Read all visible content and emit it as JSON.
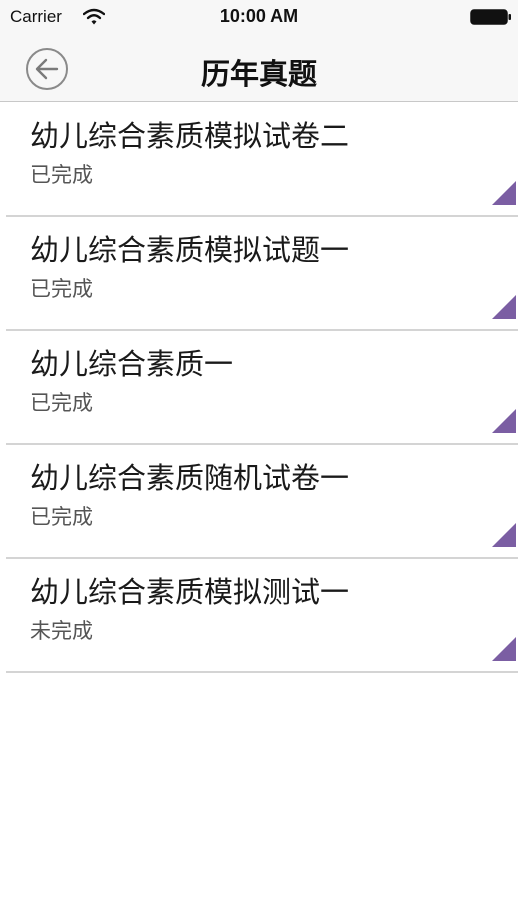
{
  "status_bar": {
    "carrier": "Carrier",
    "time": "10:00 AM"
  },
  "nav": {
    "title": "历年真题",
    "back_icon": "back-arrow-icon"
  },
  "colors": {
    "accent_triangle": "#7b5ea3",
    "divider": "#d4d4d4"
  },
  "items": [
    {
      "title": "幼儿综合素质模拟试卷二",
      "status": "已完成"
    },
    {
      "title": "幼儿综合素质模拟试题一",
      "status": "已完成"
    },
    {
      "title": "幼儿综合素质一",
      "status": "已完成"
    },
    {
      "title": "幼儿综合素质随机试卷一",
      "status": "已完成"
    },
    {
      "title": "幼儿综合素质模拟测试一",
      "status": "未完成"
    }
  ]
}
